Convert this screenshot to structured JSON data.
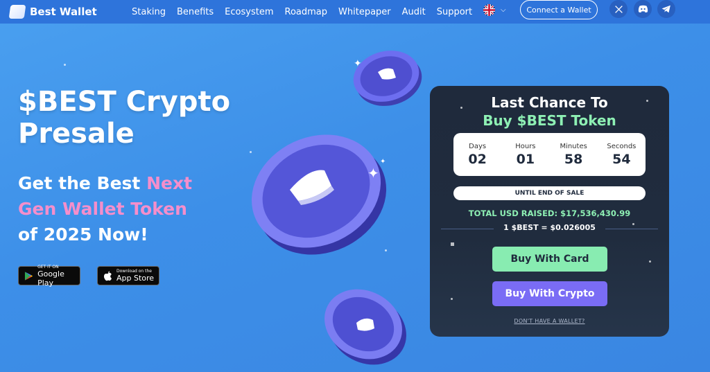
{
  "nav": {
    "logo_text": "Best Wallet",
    "links": [
      "Staking",
      "Benefits",
      "Ecosystem",
      "Roadmap",
      "Whitepaper",
      "Audit",
      "Support"
    ],
    "connect_label": "Connect a Wallet",
    "language_icon": "uk-flag-icon",
    "socials": [
      "x-icon",
      "discord-icon",
      "telegram-icon"
    ]
  },
  "hero": {
    "title_line1": "$BEST Crypto",
    "title_line2": "Presale",
    "sub_part1": "Get the Best ",
    "sub_highlight1": "Next",
    "sub_highlight2": "Gen Wallet Token",
    "sub_part2": "of 2025 Now!",
    "google_small": "GET IT ON",
    "google_big": "Google Play",
    "apple_small": "Download on the",
    "apple_big": "App Store"
  },
  "card": {
    "title1": "Last Chance To",
    "title2": "Buy $BEST Token",
    "countdown": [
      {
        "label": "Days",
        "value": "02"
      },
      {
        "label": "Hours",
        "value": "01"
      },
      {
        "label": "Minutes",
        "value": "58"
      },
      {
        "label": "Seconds",
        "value": "54"
      }
    ],
    "until": "UNTIL END OF SALE",
    "raised": "TOTAL USD RAISED: $17,536,430.99",
    "price": "1 $BEST = $0.026005",
    "buy_card": "Buy With Card",
    "buy_crypto": "Buy With Crypto",
    "no_wallet": "DON'T HAVE A WALLET?"
  },
  "colors": {
    "accent_green": "#88ecb1",
    "accent_purple": "#7a6cf5",
    "pink": "#f58ecb",
    "nav_bg": "#2e74db"
  }
}
